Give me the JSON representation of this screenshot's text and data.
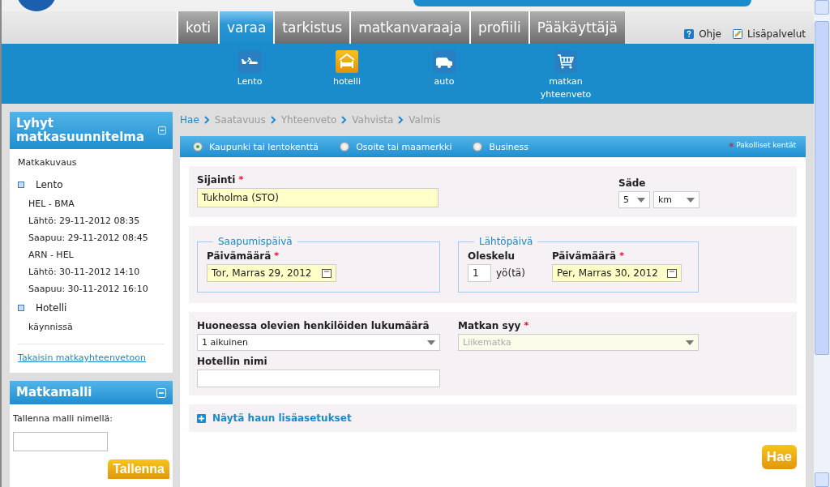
{
  "nav": {
    "tabs": [
      {
        "label": "koti",
        "selected": false
      },
      {
        "label": "varaa",
        "selected": true
      },
      {
        "label": "tarkistus",
        "selected": false
      },
      {
        "label": "matkanvaraaja",
        "selected": false
      },
      {
        "label": "profiili",
        "selected": false
      },
      {
        "label": "Pääkäyttäjä",
        "selected": false
      }
    ],
    "links": [
      {
        "label": "Ohje",
        "kind": "help"
      },
      {
        "label": "Lisäpalvelut",
        "kind": "edit"
      }
    ]
  },
  "services": [
    {
      "label": "Lento",
      "kind": "flight",
      "selected": false
    },
    {
      "label": "hotelli",
      "kind": "hotel",
      "selected": true
    },
    {
      "label": "auto",
      "kind": "car",
      "selected": false
    },
    {
      "label": "matkan yhteenveto",
      "kind": "cart",
      "selected": false
    }
  ],
  "trip_summary": {
    "title": "Lyhyt matkasuunnitelma",
    "heading": "Matkakuvaus",
    "sections": [
      {
        "label": "Lento",
        "lines": [
          "HEL - BMA",
          "Lähtö: 29-11-2012 08:35",
          "Saapuu: 29-11-2012 08:45",
          "ARN - HEL",
          "Lähtö: 30-11-2012 14:10",
          "Saapuu: 30-11-2012 16:10"
        ]
      },
      {
        "label": "Hotelli",
        "lines": [
          "käynnissä"
        ]
      }
    ],
    "link": "Takaisin matkayhteenvetoon"
  },
  "template": {
    "title": "Matkamalli",
    "label": "Tallenna malli nimellä:",
    "button": "Tallenna"
  },
  "steps": [
    {
      "label": "Hae",
      "selected": true
    },
    {
      "label": "Saatavuus",
      "selected": false
    },
    {
      "label": "Yhteenveto",
      "selected": false
    },
    {
      "label": "Vahvista",
      "selected": false
    },
    {
      "label": "Valmis",
      "selected": false
    }
  ],
  "search_types": [
    {
      "label": "Kaupunki tai lentokenttä",
      "selected": true
    },
    {
      "label": "Osoite tai maamerkki",
      "selected": false
    },
    {
      "label": "Business",
      "selected": false
    }
  ],
  "required_mark": "*",
  "required_note": "Pakolliset kentät",
  "location": {
    "label": "Sijainti",
    "required": true,
    "value": "Tukholma (STO)"
  },
  "radius": {
    "label": "Säde",
    "value": "5",
    "unit": "km"
  },
  "arrival": {
    "legend": "Saapumispäivä",
    "date_label": "Päivämäärä",
    "required": true,
    "value": "Tor, Marras 29, 2012"
  },
  "departure": {
    "legend": "Lähtöpäivä",
    "stay_label": "Oleskelu",
    "nights": "1",
    "nights_unit": "yö(tä)",
    "date_label": "Päivämäärä",
    "required": true,
    "value": "Per, Marras 30, 2012"
  },
  "guests": {
    "label": "Huoneessa olevien henkilöiden lukumäärä",
    "value": "1 aikuinen"
  },
  "purpose": {
    "label": "Matkan syy",
    "required": true,
    "value": "Liikematka",
    "disabled": true
  },
  "hotel_name": {
    "label": "Hotellin nimi"
  },
  "advanced": {
    "label": "Näytä haun lisäasetukset",
    "expanded": false
  },
  "search_button": "Hae"
}
